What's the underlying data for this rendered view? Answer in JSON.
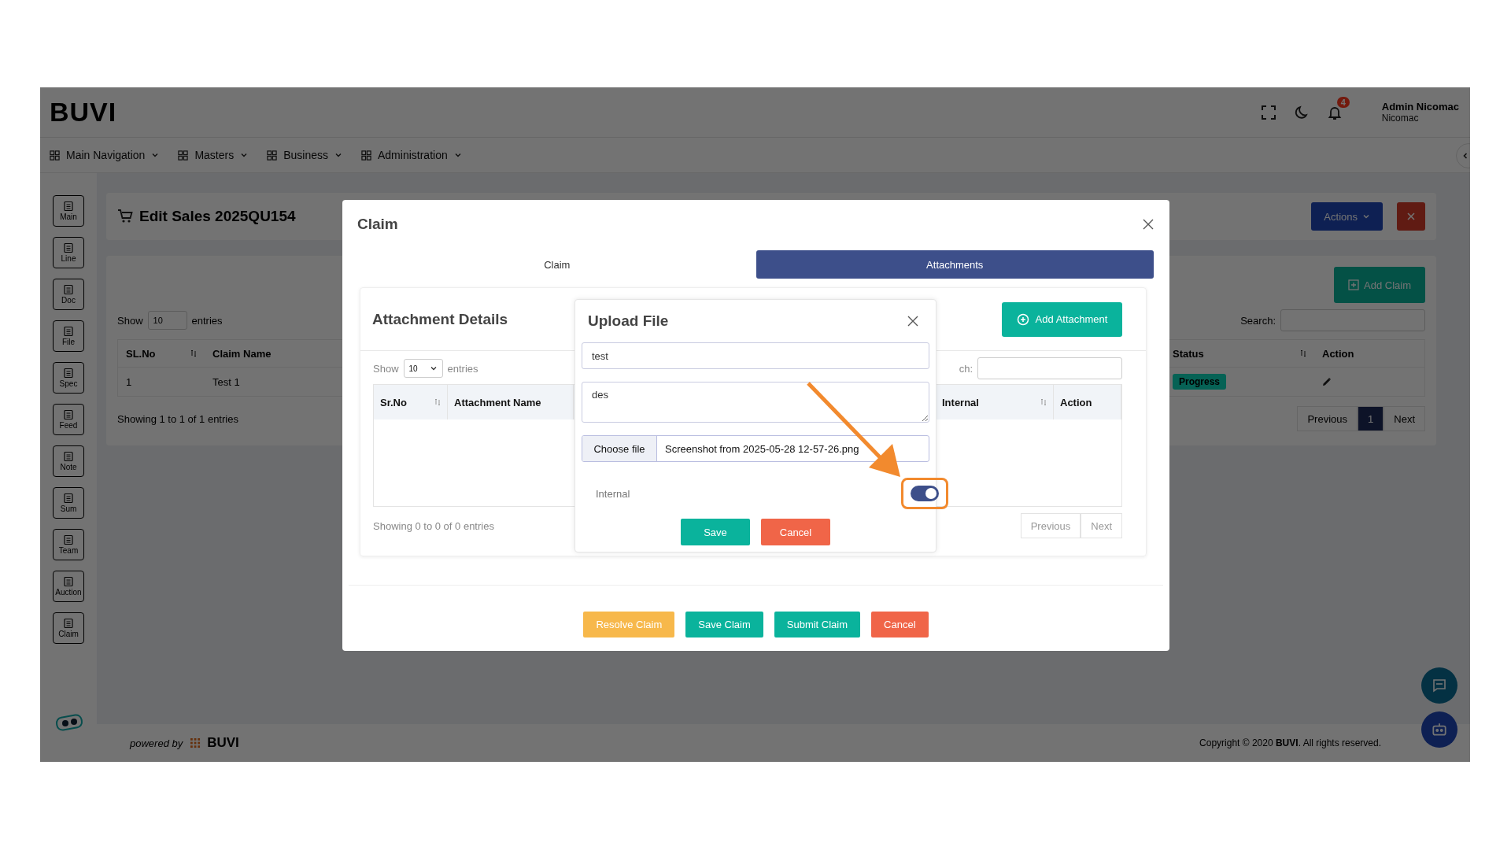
{
  "app": {
    "logo": "BUVI",
    "notification_count": "4",
    "user_name": "Admin Nicomac",
    "user_company": "Nicomac"
  },
  "nav": [
    {
      "label": "Main Navigation"
    },
    {
      "label": "Masters"
    },
    {
      "label": "Business"
    },
    {
      "label": "Administration"
    }
  ],
  "sidebar": [
    {
      "label": "Main"
    },
    {
      "label": "Line"
    },
    {
      "label": "Doc"
    },
    {
      "label": "File"
    },
    {
      "label": "Spec"
    },
    {
      "label": "Feed"
    },
    {
      "label": "Note"
    },
    {
      "label": "Sum"
    },
    {
      "label": "Team"
    },
    {
      "label": "Auction"
    },
    {
      "label": "Claim"
    }
  ],
  "page": {
    "title": "Edit Sales 2025QU154",
    "actions_button": "Actions",
    "add_claim_button": "Add Claim",
    "show_label": "Show",
    "page_size": "10",
    "entries_label": "entries",
    "search_label": "Search:",
    "columns": [
      {
        "label": "SL.No",
        "sortable": true
      },
      {
        "label": "Claim Name"
      },
      {
        "label": "Status",
        "sortable": true
      },
      {
        "label": "Action",
        "sortable": false
      }
    ],
    "rows": [
      {
        "sl_no": "1",
        "claim_name": "Test 1",
        "status": "Progress"
      }
    ],
    "info": "Showing 1 to 1 of 1 entries",
    "previous": "Previous",
    "pages": [
      {
        "label": "1",
        "selected": true
      }
    ],
    "next": "Next"
  },
  "footer": {
    "powered_by": "powered by",
    "brand": "BUVI",
    "copyright": "Copyright © 2020 **BUVI**. All rights reserved."
  },
  "modal": {
    "title": "Claim",
    "tabs": [
      {
        "label": "Claim",
        "selected": false
      },
      {
        "label": "Attachments",
        "selected": true
      }
    ],
    "attachments": {
      "heading": "Attachment Details",
      "add_button": "Add Attachment",
      "show_label": "Show",
      "page_size": "10",
      "entries_label": "entries",
      "search_label": "ch:",
      "columns": [
        {
          "label": "Sr.No",
          "sortable": true
        },
        {
          "label": "Attachment Name",
          "sortable": false
        },
        {
          "label": "Internal",
          "sortable": true
        },
        {
          "label": "Action",
          "sortable": false
        }
      ],
      "info": "Showing 0 to 0 of 0 entries",
      "previous": "Previous",
      "next": "Next"
    },
    "upload": {
      "title": "Upload File",
      "name_value": "test",
      "description_value": "des",
      "choose_button": "Choose file",
      "file_name": "Screenshot from 2025-05-28 12-57-26.png",
      "internal_label": "Internal",
      "internal_on": true,
      "save_button": "Save",
      "cancel_button": "Cancel"
    },
    "buttons": [
      {
        "label": "Resolve Claim",
        "kind": "warning"
      },
      {
        "label": "Save Claim",
        "kind": "primary"
      },
      {
        "label": "Submit Claim",
        "kind": "primary"
      },
      {
        "label": "Cancel",
        "kind": "danger"
      }
    ]
  }
}
